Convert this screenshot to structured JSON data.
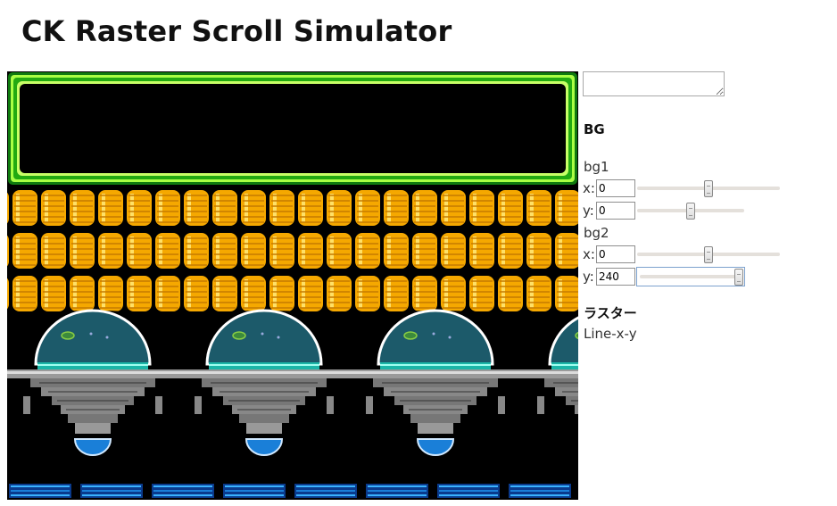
{
  "title": "CK Raster Scroll Simulator",
  "memo": {
    "value": ""
  },
  "bg_section": {
    "title": "BG",
    "bg1": {
      "label": "bg1",
      "x_label": "x:",
      "x_value": "0",
      "x_slider": 0.5,
      "y_label": "y:",
      "y_value": "0",
      "y_slider": 0.5
    },
    "bg2": {
      "label": "bg2",
      "x_label": "x:",
      "x_value": "0",
      "x_slider": 0.5,
      "y_label": "y:",
      "y_value": "240",
      "y_slider": 1.0
    }
  },
  "raster": {
    "title": "ラスター",
    "format": "Line-x-y"
  },
  "colors": {
    "frame_green": "#22aa11",
    "frame_light": "#aaff44",
    "coin": "#f5a800",
    "dome": "#1c5a6a",
    "water": "#1a7fd8"
  }
}
